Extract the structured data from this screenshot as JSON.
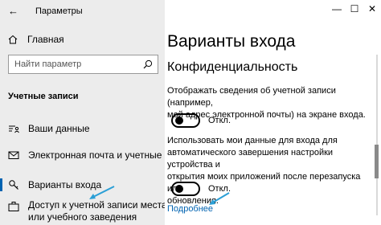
{
  "window": {
    "title": "Параметры",
    "controls": {
      "minimize": "—",
      "maximize": "☐",
      "close": "✕"
    }
  },
  "sidebar": {
    "back": "←",
    "home_label": "Главная",
    "search_placeholder": "Найти параметр",
    "section_label": "Учетные записи",
    "items": [
      {
        "label": "Ваши данные",
        "icon": "person-list-icon"
      },
      {
        "label": "Электронная почта и учетные записи",
        "icon": "mail-icon"
      },
      {
        "label": "Варианты входа",
        "icon": "key-icon",
        "selected": true
      },
      {
        "label": "Доступ к учетной записи места работы или учебного заведения",
        "label_line1": "Доступ к учетной записи места работ",
        "label_line2": "или учебного заведения",
        "icon": "briefcase-icon"
      }
    ]
  },
  "main": {
    "title": "Варианты входа",
    "section": "Конфиденциальность",
    "setting1": {
      "description": "Отображать сведения об учетной записи (например, мой адрес электронной почты) на экране входа.",
      "line1": "Отображать сведения об учетной записи (например,",
      "line2": "мой адрес электронной почты) на экране входа.",
      "state": "Откл."
    },
    "setting2": {
      "line1": "Использовать мои данные для входа для",
      "line2": "автоматического завершения настройки устройства и",
      "line3": "открытия моих приложений после перезапуска или",
      "line4": "обновления.",
      "state": "Откл."
    },
    "link": "Подробнее"
  },
  "colors": {
    "accent": "#0063b1",
    "sidebar_bg": "#ececec",
    "arrow": "#2b9fd6"
  }
}
